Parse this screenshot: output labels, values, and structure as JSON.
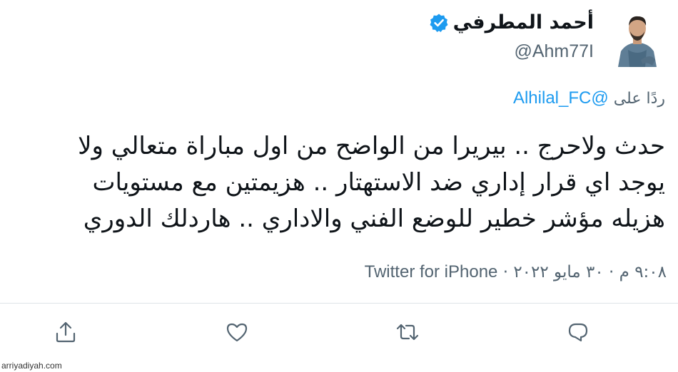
{
  "author": {
    "display_name": "أحمد المطرفي",
    "handle": "@Ahm77I",
    "verified": true
  },
  "reply": {
    "prefix": "ردًا على",
    "mention": "@Alhilal_FC"
  },
  "tweet": {
    "lines": [
      "حدث ولاحرج .. بيريرا من الواضح من اول مباراة متعالي ولا",
      "يوجد اي قرار إداري ضد الاستهتار .. هزيمتين مع مستويات",
      "هزيله مؤشر خطير للوضع الفني والاداري .. هاردلك الدوري"
    ],
    "timestamp": "٩:٠٨ م · ٣٠ مايو ٢٠٢٢",
    "separator": " · ",
    "source": "Twitter for iPhone"
  },
  "actions": {
    "reply_icon": "reply-icon",
    "retweet_icon": "retweet-icon",
    "like_icon": "heart-icon",
    "share_icon": "share-icon"
  },
  "watermark": "arriyadiyah.com",
  "colors": {
    "accent": "#1d9bf0",
    "text": "#0f1419",
    "secondary": "#536471"
  }
}
